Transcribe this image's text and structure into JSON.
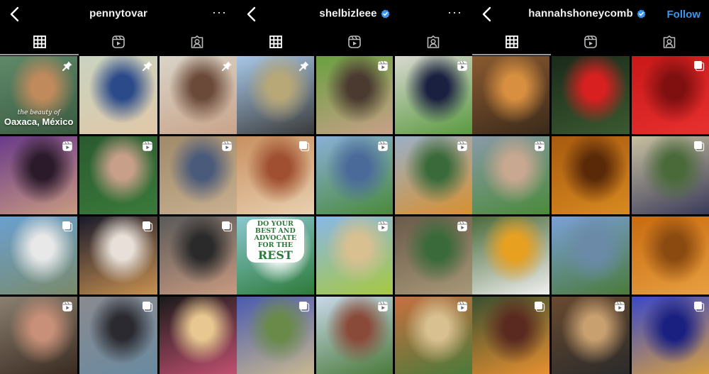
{
  "panels": [
    {
      "username": "pennytovar",
      "verified": false,
      "action": "more",
      "action_label": "···",
      "tabs": [
        {
          "name": "posts-grid",
          "icon": "grid-icon",
          "active": true
        },
        {
          "name": "reels",
          "icon": "reels-icon",
          "active": false
        },
        {
          "name": "tagged",
          "icon": "tagged-icon",
          "active": false
        }
      ],
      "tiles": [
        {
          "desc": "woman smiling by turquoise river",
          "badge": "pin",
          "caption_small": "the beauty of",
          "caption": "Oaxaca, México",
          "colors": [
            "#5f8a6a",
            "#c08a5c",
            "#3a5a40"
          ]
        },
        {
          "desc": "smiling person in blue scrubs with face mask",
          "badge": "pin",
          "colors": [
            "#c9d3c0",
            "#2a4a8a",
            "#e0c8a8"
          ]
        },
        {
          "desc": "woman laughing with hand in hair",
          "badge": "pin",
          "colors": [
            "#d9d4c8",
            "#6b4a3a",
            "#c9a48a"
          ]
        },
        {
          "desc": "two women posing on purple background",
          "badge": "reel",
          "colors": [
            "#6a3a8a",
            "#2a1a2a",
            "#c89a80"
          ]
        },
        {
          "desc": "woman holding cream jar among plants",
          "badge": "reel",
          "colors": [
            "#2a5a30",
            "#c8a08a",
            "#3a7a3a"
          ]
        },
        {
          "desc": "woman in dress waving in lobby",
          "badge": "reel",
          "colors": [
            "#a08a6a",
            "#4a5a7a",
            "#c8b090"
          ]
        },
        {
          "desc": "woman in white outfit at poolside railing",
          "badge": "carousel",
          "colors": [
            "#6aa0d0",
            "#e8e8e8",
            "#7a8a6a"
          ]
        },
        {
          "desc": "person in white shirt at night city",
          "badge": "carousel",
          "colors": [
            "#1a1a2a",
            "#e8e0d8",
            "#c89050"
          ]
        },
        {
          "desc": "woman in leather jacket against grey wall",
          "badge": "carousel",
          "colors": [
            "#5a5a5a",
            "#2a2a2a",
            "#c89a80"
          ]
        },
        {
          "desc": "close-up applying lip liner",
          "badge": "reel",
          "colors": [
            "#8a8070",
            "#c89078",
            "#3a2a20"
          ]
        },
        {
          "desc": "person in denim skirt on city street",
          "badge": "carousel",
          "colors": [
            "#8a8a90",
            "#2a2a30",
            "#6a8aa0"
          ]
        },
        {
          "desc": "two friends with cowboy hat at night",
          "badge": "none",
          "colors": [
            "#1a1a1a",
            "#e8c890",
            "#c05070"
          ]
        }
      ]
    },
    {
      "username": "shelbizleee",
      "verified": true,
      "action": "more",
      "action_label": "···",
      "tabs": [
        {
          "name": "posts-grid",
          "icon": "grid-icon",
          "active": false
        },
        {
          "name": "reels",
          "icon": "reels-icon",
          "active": false
        },
        {
          "name": "tagged",
          "icon": "tagged-icon",
          "active": false
        }
      ],
      "tiles": [
        {
          "desc": "city skyline park with people on grass",
          "badge": "pin",
          "colors": [
            "#a8c8e8",
            "#b8a878",
            "#3a3a3a"
          ]
        },
        {
          "desc": "selfie under green tree with sunglasses",
          "badge": "reel",
          "colors": [
            "#6aa040",
            "#4a3a30",
            "#c8a088"
          ]
        },
        {
          "desc": "two women holding solar panel by house",
          "badge": "reel",
          "colors": [
            "#d8d8d0",
            "#1a2040",
            "#5a9a40"
          ]
        },
        {
          "desc": "woman under red rock arch",
          "badge": "carousel",
          "colors": [
            "#c89060",
            "#a05030",
            "#e8d0b0"
          ]
        },
        {
          "desc": "woman in denim jacket by lake with skyline",
          "badge": "reel",
          "colors": [
            "#8ab0d8",
            "#4a6a9a",
            "#4a8a3a"
          ]
        },
        {
          "desc": "woman running in orange flower field",
          "badge": "reel",
          "colors": [
            "#9ab0c8",
            "#3a6a3a",
            "#d89030"
          ]
        },
        {
          "desc": "illustrated poster with two women",
          "badge": "none",
          "poster_lines": [
            "DO YOUR",
            "BEST AND",
            "ADVOCATE",
            "FOR THE"
          ],
          "poster_big": "REST",
          "colors": [
            "#8ac8d0",
            "#ffffff",
            "#2d7a3a"
          ]
        },
        {
          "desc": "woman with sunglasses holding popsicle",
          "badge": "reel",
          "colors": [
            "#88b8e8",
            "#d8c090",
            "#a8c840"
          ]
        },
        {
          "desc": "woman hugging large tree",
          "badge": "reel",
          "colors": [
            "#6a5a4a",
            "#3a6a3a",
            "#a89878"
          ]
        },
        {
          "desc": "couple in bluebonnet field",
          "badge": "carousel",
          "colors": [
            "#4a5ab0",
            "#6a8a4a",
            "#c8b890"
          ]
        },
        {
          "desc": "city buildings and green walkway",
          "badge": "reel",
          "colors": [
            "#c8d8e8",
            "#8a4a3a",
            "#4a7a3a"
          ]
        },
        {
          "desc": "woman with hat at farmers market",
          "badge": "reel",
          "colors": [
            "#c87040",
            "#d8c090",
            "#4a7a3a"
          ]
        }
      ]
    },
    {
      "username": "hannahshoneycomb",
      "verified": true,
      "action": "follow",
      "action_label": "Follow",
      "tabs": [
        {
          "name": "posts-grid",
          "icon": "grid-icon",
          "active": true
        },
        {
          "name": "reels",
          "icon": "reels-icon",
          "active": false
        },
        {
          "name": "tagged",
          "icon": "tagged-icon",
          "active": false
        }
      ],
      "tiles": [
        {
          "desc": "cluster of honeybees",
          "badge": "none",
          "colors": [
            "#8a5a30",
            "#d89040",
            "#3a2a1a"
          ]
        },
        {
          "desc": "bee flying to red flower",
          "badge": "none",
          "colors": [
            "#1a2a1a",
            "#d82020",
            "#3a5a30"
          ]
        },
        {
          "desc": "red tulip close-up",
          "badge": "carousel",
          "colors": [
            "#c81818",
            "#801010",
            "#e83030"
          ]
        },
        {
          "desc": "woman holding bees in hand",
          "badge": "reel",
          "colors": [
            "#8a9aa8",
            "#c8a890",
            "#4a8a3a"
          ]
        },
        {
          "desc": "honeycomb cells with bee",
          "badge": "none",
          "colors": [
            "#a85a10",
            "#5a2a08",
            "#d88a20"
          ]
        },
        {
          "desc": "beekeeper photographing hive frame",
          "badge": "carousel",
          "colors": [
            "#c8c0a0",
            "#4a6a3a",
            "#3a3a5a"
          ]
        },
        {
          "desc": "bee on daisy flower",
          "badge": "none",
          "colors": [
            "#4a6a3a",
            "#e8a020",
            "#f0f0f0"
          ]
        },
        {
          "desc": "smiling woman in overalls in field",
          "badge": "none",
          "colors": [
            "#7aa0d8",
            "#6a8aa8",
            "#4a7a3a"
          ]
        },
        {
          "desc": "bee on orange honeycomb",
          "badge": "none",
          "colors": [
            "#c86a10",
            "#8a4a10",
            "#e8a040"
          ]
        },
        {
          "desc": "zebra butterfly on flower",
          "badge": "carousel",
          "colors": [
            "#3a5030",
            "#5a2a20",
            "#e89030"
          ]
        },
        {
          "desc": "bees on honeycomb frame",
          "badge": "reel",
          "colors": [
            "#6a4a30",
            "#c8a070",
            "#2a2a2a"
          ]
        },
        {
          "desc": "bee on blue grape hyacinth",
          "badge": "carousel",
          "colors": [
            "#3a48c8",
            "#1a2080",
            "#d8a040"
          ]
        }
      ]
    }
  ],
  "colors": {
    "background": "#000000",
    "text": "#f2f2f2",
    "verified": "#3897f0",
    "follow": "#3897f0",
    "tab_indicator": "#9a9a9a"
  }
}
